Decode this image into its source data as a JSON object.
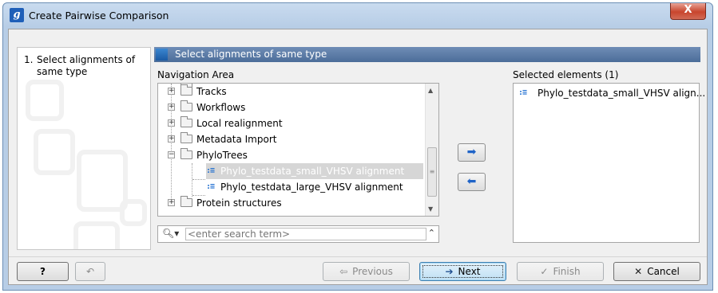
{
  "window": {
    "title": "Create Pairwise Comparison",
    "app_icon_letter": "g",
    "close_label": "X"
  },
  "steps": [
    {
      "number": "1.",
      "label": "Select alignments of same type"
    }
  ],
  "panel": {
    "header": "Select alignments of same type"
  },
  "navigation": {
    "label": "Navigation Area",
    "items": [
      {
        "label": "Tracks",
        "type": "folder",
        "expander": "+"
      },
      {
        "label": "Workflows",
        "type": "folder",
        "expander": "+"
      },
      {
        "label": "Local realignment",
        "type": "folder",
        "expander": "+"
      },
      {
        "label": "Metadata Import",
        "type": "folder",
        "expander": "+"
      },
      {
        "label": "PhyloTrees",
        "type": "folder",
        "expander": "−"
      },
      {
        "label": "Phylo_testdata_small_VHSV alignment",
        "type": "alignment",
        "selected": true
      },
      {
        "label": "Phylo_testdata_large_VHSV alignment",
        "type": "alignment"
      },
      {
        "label": "Protein structures",
        "type": "folder",
        "expander": "+"
      }
    ],
    "search": {
      "placeholder": "<enter search term>",
      "value": ""
    }
  },
  "transfer": {
    "add_icon": "right-arrow-icon",
    "remove_icon": "left-arrow-icon",
    "add_glyph": "➡",
    "remove_glyph": "⬅"
  },
  "selected": {
    "label": "Selected elements (1)",
    "items": [
      {
        "label": "Phylo_testdata_small_VHSV align..."
      }
    ]
  },
  "buttons": {
    "help": "?",
    "reset_glyph": "↶",
    "previous": "Previous",
    "next": "Next",
    "finish": "Finish",
    "cancel": "Cancel"
  },
  "colors": {
    "accent": "#1f63c7",
    "header": "#4c6d99",
    "close": "#c8452d"
  }
}
